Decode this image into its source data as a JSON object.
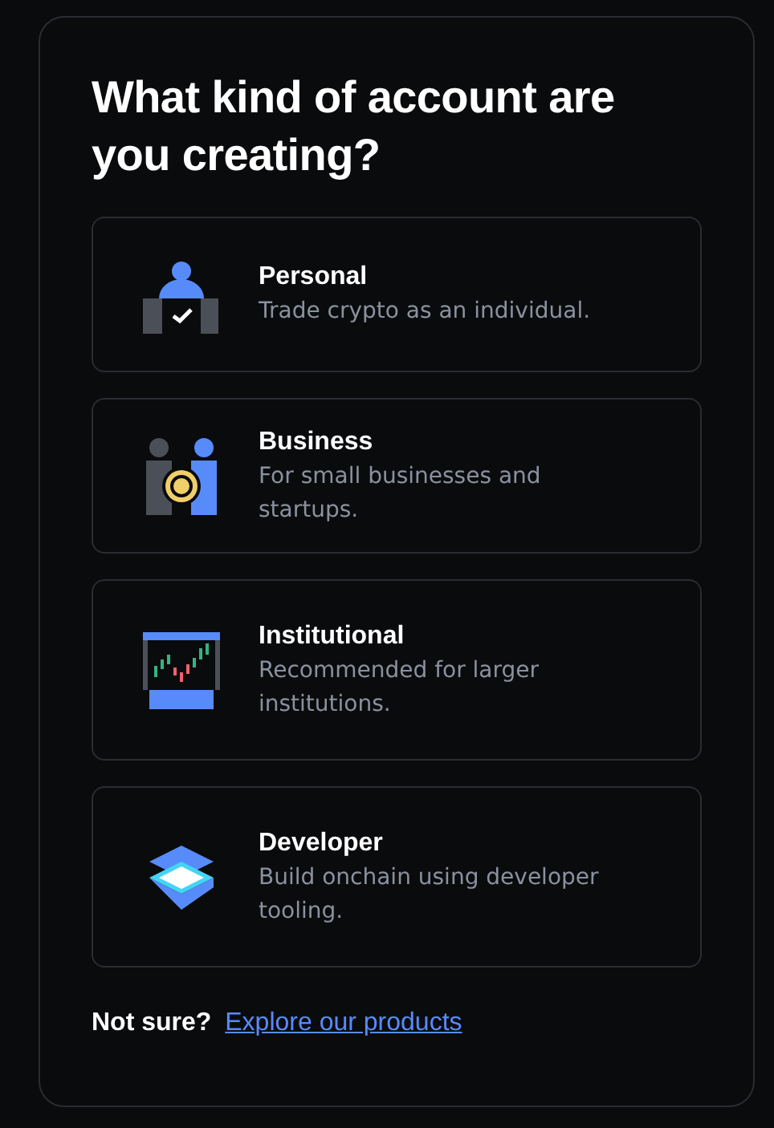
{
  "heading": "What kind of account are you creating?",
  "options": [
    {
      "kind": "personal",
      "title": "Personal",
      "description": "Trade crypto as an individual."
    },
    {
      "kind": "business",
      "title": "Business",
      "description": "For small businesses and startups."
    },
    {
      "kind": "institutional",
      "title": "Institutional",
      "description": "Recommended for larger institutions."
    },
    {
      "kind": "developer",
      "title": "Developer",
      "description": "Build onchain using developer tooling."
    }
  ],
  "footer": {
    "prompt": "Not sure?",
    "link": "Explore our products"
  }
}
